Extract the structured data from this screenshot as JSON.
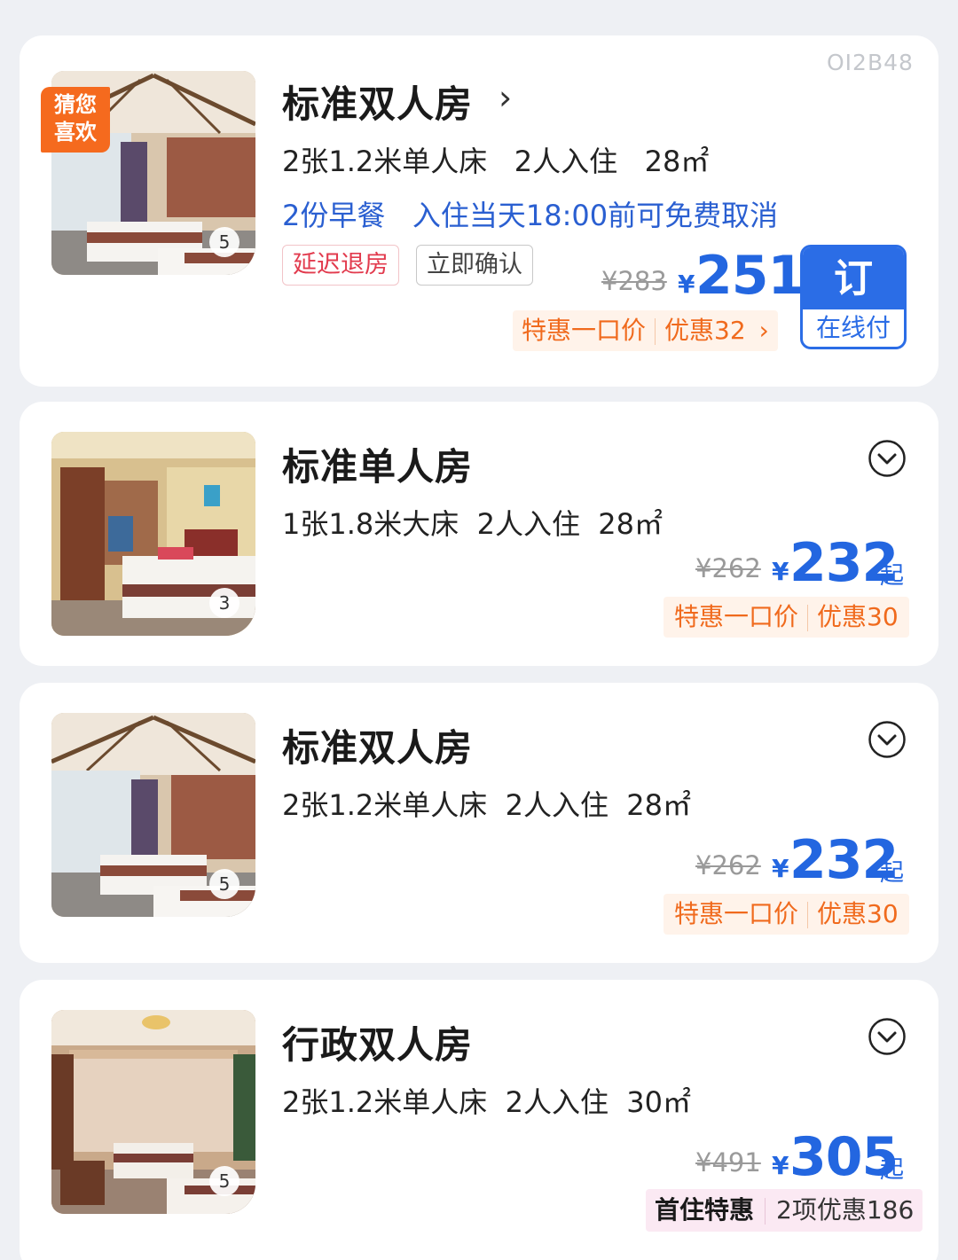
{
  "rooms": [
    {
      "name": "标准双人房",
      "specs": "2张1.2米单人床   2人入住   28㎡",
      "benefits": "2份早餐   入住当天18:00前可免费取消",
      "tags": [
        "延迟退房",
        "立即确认"
      ],
      "photo_count": "5",
      "badge": "猜您\n喜欢",
      "badge_line1": "猜您",
      "badge_line2": "喜欢",
      "watermark": "OI2B48",
      "original_price": "¥283",
      "currency": "¥",
      "price": "251",
      "promo_label": "特惠一口价",
      "promo_discount": "优惠32",
      "book_label": "订",
      "book_sub": "在线付"
    },
    {
      "name": "标准单人房",
      "specs": "1张1.8米大床  2人入住  28㎡",
      "photo_count": "3",
      "original_price": "¥262",
      "currency": "¥",
      "price": "232",
      "price_suffix": "起",
      "promo_label": "特惠一口价",
      "promo_discount": "优惠30"
    },
    {
      "name": "标准双人房",
      "specs": "2张1.2米单人床  2人入住  28㎡",
      "photo_count": "5",
      "original_price": "¥262",
      "currency": "¥",
      "price": "232",
      "price_suffix": "起",
      "promo_label": "特惠一口价",
      "promo_discount": "优惠30"
    },
    {
      "name": "行政双人房",
      "specs": "2张1.2米单人床  2人入住  30㎡",
      "photo_count": "5",
      "original_price": "¥491",
      "currency": "¥",
      "price": "305",
      "price_suffix": "起",
      "first_stay_label": "首住特惠",
      "first_stay_discount": "2项优惠186"
    }
  ],
  "colors": {
    "accent_blue": "#2366e0",
    "promo_orange": "#f06a1d",
    "guess_tag_orange": "#f56a1e",
    "tag_red": "#e23b4e",
    "benefit_blue": "#2a5fd1"
  },
  "icons": {
    "chevron_right": "chevron-right-icon",
    "expand": "chevron-down-circle-icon"
  }
}
